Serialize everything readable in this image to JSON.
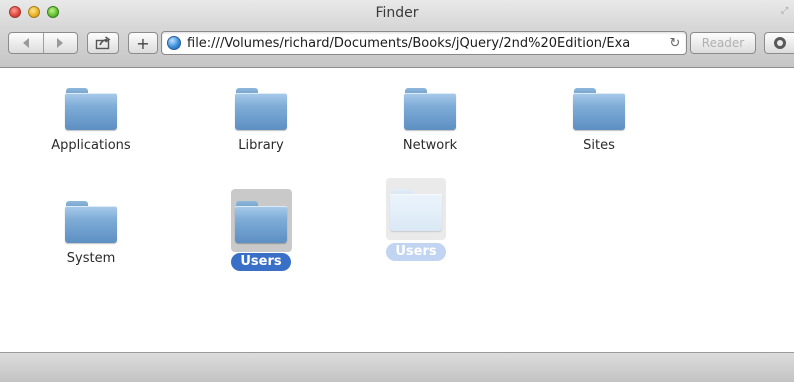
{
  "window": {
    "title": "Finder"
  },
  "toolbar": {
    "url": "file:///Volumes/richard/Documents/Books/jQuery/2nd%20Edition/Exa",
    "reader_label": "Reader",
    "plus_label": "+"
  },
  "items": [
    {
      "label": "Applications"
    },
    {
      "label": "Library"
    },
    {
      "label": "Network"
    },
    {
      "label": "Sites"
    },
    {
      "label": "System"
    },
    {
      "label": "Users"
    }
  ],
  "drag_ghost": {
    "label": "Users"
  }
}
